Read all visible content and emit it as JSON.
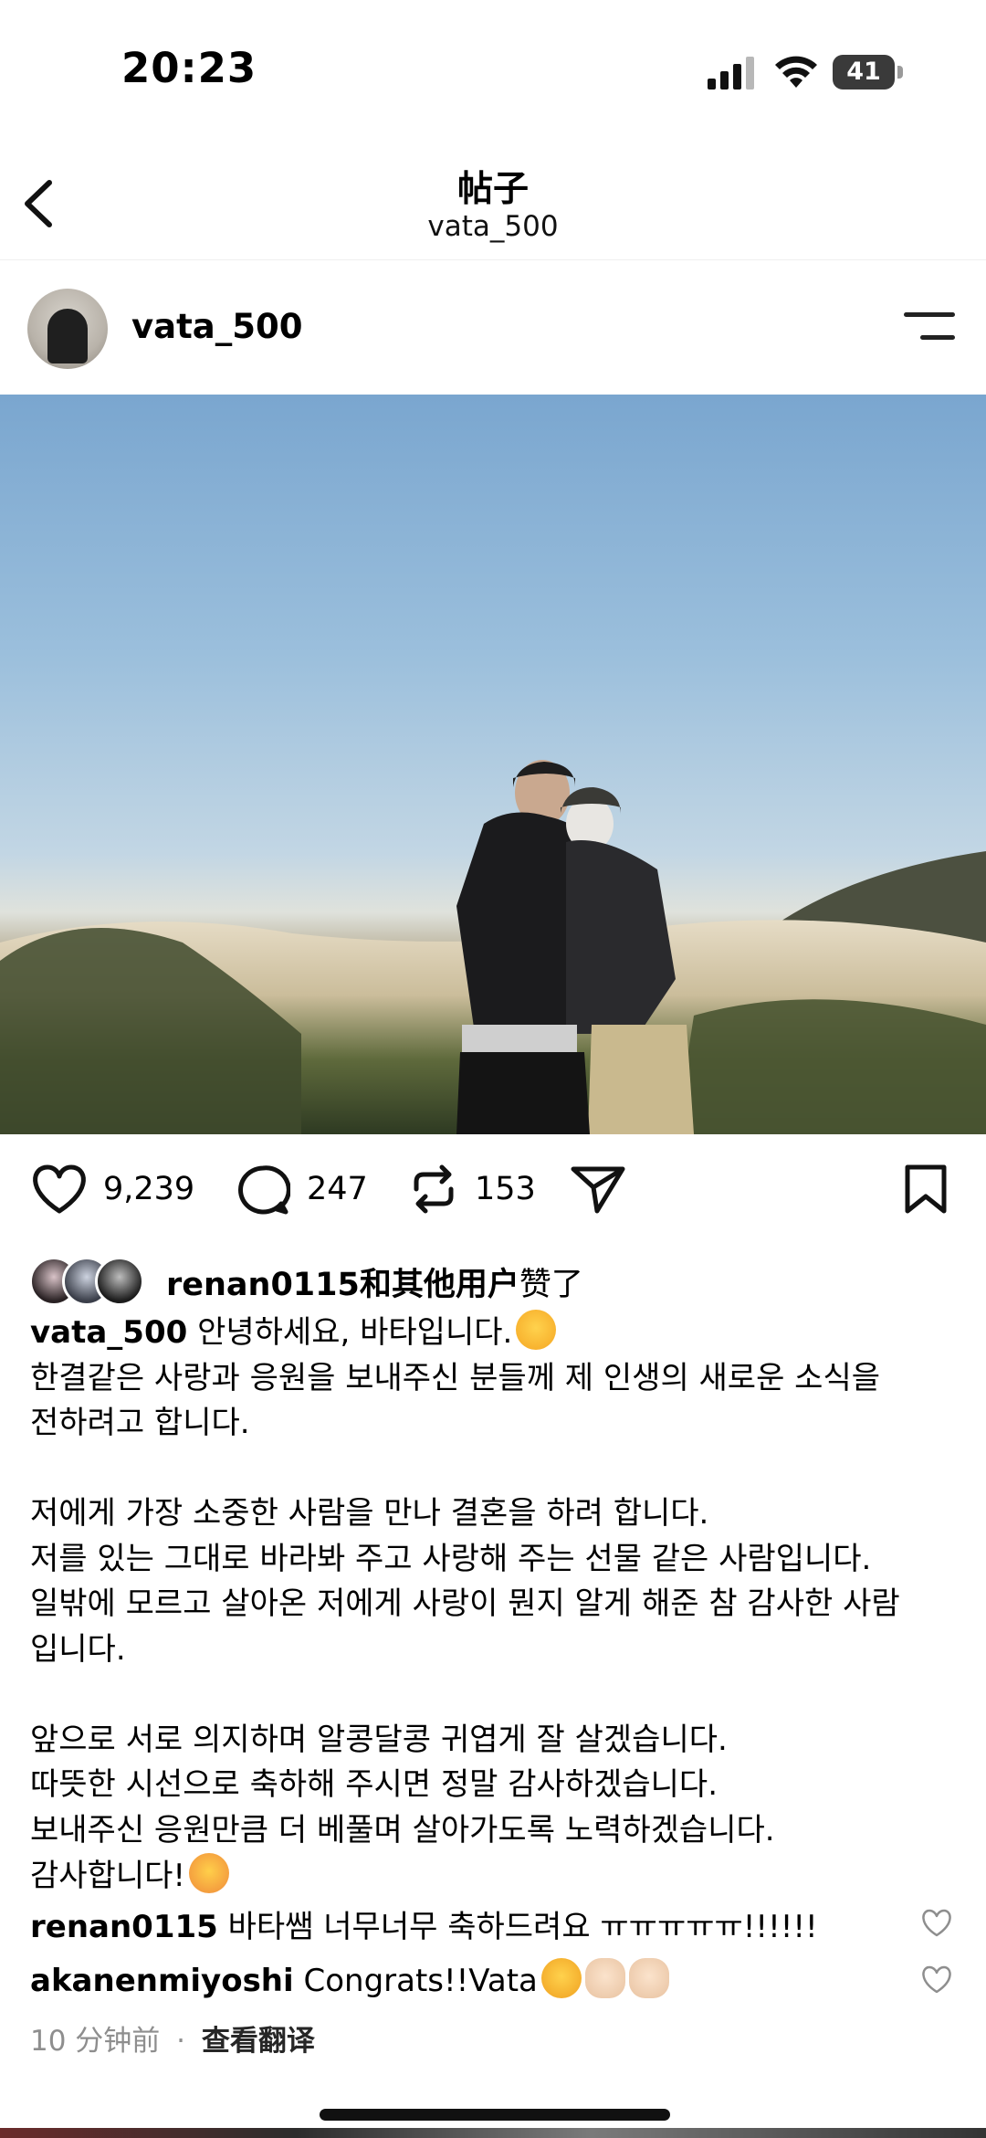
{
  "status_bar": {
    "time": "20:23",
    "battery": "41"
  },
  "header": {
    "title": "帖子",
    "subtitle": "vata_500"
  },
  "post": {
    "author": "vata_500",
    "likes_count": "9,239",
    "comments_count": "247",
    "reposts_count": "153",
    "liked_by": {
      "user": "renan0115",
      "suffix": "和其他用户",
      "verb": "赞了"
    },
    "caption": {
      "user": "vata_500",
      "first_line": "안녕하세요, 바타입니다.",
      "lines": [
        "한결같은 사랑과 응원을 보내주신 분들께 제 인생의 새로운 소식을",
        "전하려고 합니다.",
        "",
        "저에게 가장 소중한 사람을 만나 결혼을 하려 합니다.",
        "저를 있는 그대로 바라봐 주고 사랑해 주는 선물 같은 사람입니다.",
        "일밖에 모르고 살아온 저에게 사랑이 뭔지 알게 해준 참 감사한 사람",
        "입니다.",
        "",
        "앞으로 서로 의지하며 알콩달콩 귀엽게 잘 살겠습니다.",
        "따뜻한 시선으로 축하해 주시면 정말 감사하겠습니다.",
        "보내주신 응원만큼 더 베풀며 살아가도록 노력하겠습니다."
      ],
      "last_line": "감사합니다!"
    },
    "comments": [
      {
        "user": "renan0115",
        "text": "바타쌤 너무너무 축하드려요 ㅠㅠㅠㅠㅠ!!!!!!"
      },
      {
        "user": "akanenmiyoshi",
        "text": "Congrats!!Vata"
      }
    ],
    "time_ago": "10 分钟前",
    "separator": "·",
    "translate_label": "查看翻译"
  },
  "icons": {
    "back": "chevron-left-icon",
    "menu": "menu-icon",
    "like": "heart-icon",
    "comment": "comment-icon",
    "repost": "repost-icon",
    "share": "send-icon",
    "save": "bookmark-icon"
  }
}
